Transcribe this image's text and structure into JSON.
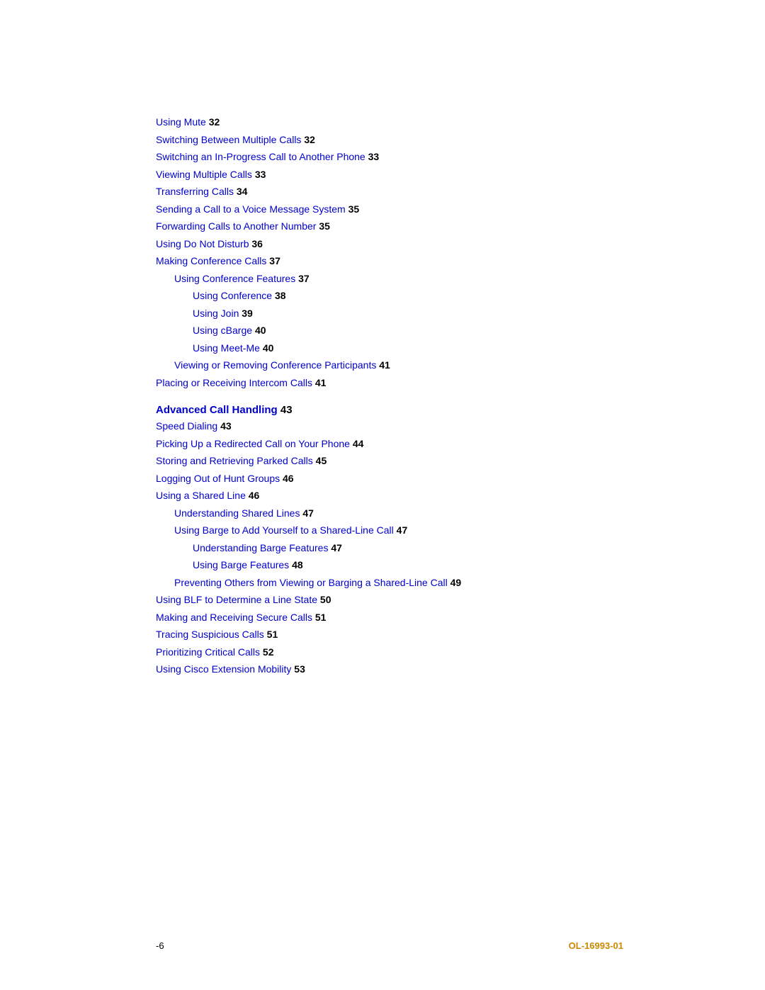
{
  "toc": {
    "entries": [
      {
        "id": "using-mute",
        "label": "Using Mute",
        "page": "32",
        "indent": 0
      },
      {
        "id": "switching-between-multiple-calls",
        "label": "Switching Between Multiple Calls",
        "page": "32",
        "indent": 0
      },
      {
        "id": "switching-in-progress-call",
        "label": "Switching an In-Progress Call to Another Phone",
        "page": "33",
        "indent": 0
      },
      {
        "id": "viewing-multiple-calls",
        "label": "Viewing Multiple Calls",
        "page": "33",
        "indent": 0
      },
      {
        "id": "transferring-calls",
        "label": "Transferring Calls",
        "page": "34",
        "indent": 0
      },
      {
        "id": "sending-call-voice-message",
        "label": "Sending a Call to a Voice Message System",
        "page": "35",
        "indent": 0
      },
      {
        "id": "forwarding-calls-another-number",
        "label": "Forwarding Calls to Another Number",
        "page": "35",
        "indent": 0
      },
      {
        "id": "using-do-not-disturb",
        "label": "Using Do Not Disturb",
        "page": "36",
        "indent": 0
      },
      {
        "id": "making-conference-calls",
        "label": "Making Conference Calls",
        "page": "37",
        "indent": 0
      },
      {
        "id": "using-conference-features",
        "label": "Using Conference Features",
        "page": "37",
        "indent": 1
      },
      {
        "id": "using-conference",
        "label": "Using Conference",
        "page": "38",
        "indent": 2
      },
      {
        "id": "using-join",
        "label": "Using Join",
        "page": "39",
        "indent": 2
      },
      {
        "id": "using-cbarge",
        "label": "Using cBarge",
        "page": "40",
        "indent": 2
      },
      {
        "id": "using-meet-me",
        "label": "Using Meet-Me",
        "page": "40",
        "indent": 2
      },
      {
        "id": "viewing-removing-conference-participants",
        "label": "Viewing or Removing Conference Participants",
        "page": "41",
        "indent": 1
      },
      {
        "id": "placing-receiving-intercom-calls",
        "label": "Placing or Receiving Intercom Calls",
        "page": "41",
        "indent": 0
      }
    ],
    "section_header": {
      "id": "advanced-call-handling",
      "label": "Advanced Call Handling",
      "page": "43"
    },
    "advanced_entries": [
      {
        "id": "speed-dialing",
        "label": "Speed Dialing",
        "page": "43",
        "indent": 0
      },
      {
        "id": "picking-up-redirected-call",
        "label": "Picking Up a Redirected Call on Your Phone",
        "page": "44",
        "indent": 0
      },
      {
        "id": "storing-retrieving-parked-calls",
        "label": "Storing and Retrieving Parked Calls",
        "page": "45",
        "indent": 0
      },
      {
        "id": "logging-out-hunt-groups",
        "label": "Logging Out of Hunt Groups",
        "page": "46",
        "indent": 0
      },
      {
        "id": "using-shared-line",
        "label": "Using a Shared Line",
        "page": "46",
        "indent": 0
      },
      {
        "id": "understanding-shared-lines",
        "label": "Understanding Shared Lines",
        "page": "47",
        "indent": 1
      },
      {
        "id": "using-barge-to-add-yourself",
        "label": "Using Barge to Add Yourself to a Shared-Line Call",
        "page": "47",
        "indent": 1
      },
      {
        "id": "understanding-barge-features",
        "label": "Understanding Barge Features",
        "page": "47",
        "indent": 2
      },
      {
        "id": "using-barge-features",
        "label": "Using Barge Features",
        "page": "48",
        "indent": 2
      },
      {
        "id": "preventing-others-viewing-barging",
        "label": "Preventing Others from Viewing or Barging a Shared-Line Call",
        "page": "49",
        "indent": 1
      },
      {
        "id": "using-blf-determine-line-state",
        "label": "Using BLF to Determine a Line State",
        "page": "50",
        "indent": 0
      },
      {
        "id": "making-receiving-secure-calls",
        "label": "Making and Receiving Secure Calls",
        "page": "51",
        "indent": 0
      },
      {
        "id": "tracing-suspicious-calls",
        "label": "Tracing Suspicious Calls",
        "page": "51",
        "indent": 0
      },
      {
        "id": "prioritizing-critical-calls",
        "label": "Prioritizing Critical Calls",
        "page": "52",
        "indent": 0
      },
      {
        "id": "using-cisco-extension-mobility",
        "label": "Using Cisco Extension Mobility",
        "page": "53",
        "indent": 0
      }
    ]
  },
  "footer": {
    "left": "-6",
    "right": "OL-16993-01"
  }
}
